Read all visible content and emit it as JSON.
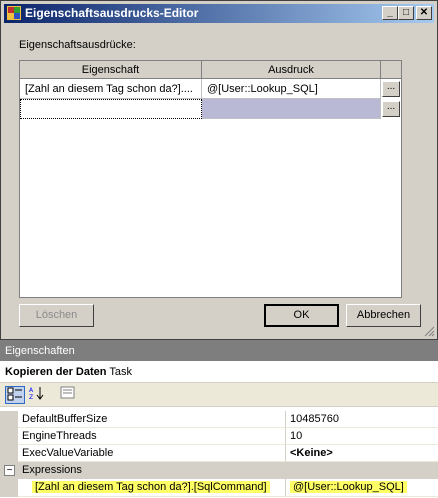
{
  "window": {
    "title": "Eigenschaftsausdrucks-Editor",
    "minimize": "_",
    "maximize": "□",
    "close": "✕"
  },
  "dialog": {
    "grid_label": "Eigenschaftsausdrücke:",
    "grid": {
      "headers": [
        "Eigenschaft",
        "Ausdruck"
      ],
      "rows": [
        {
          "property": "[Zahl an diesem Tag schon da?]....",
          "expression": "@[User::Lookup_SQL]"
        },
        {
          "property": "",
          "expression": ""
        }
      ],
      "ellipsis": "..."
    },
    "buttons": {
      "delete": "Löschen",
      "ok": "OK",
      "cancel": "Abbrechen"
    }
  },
  "properties": {
    "panel_title": "Eigenschaften",
    "object_name": "Kopieren der Daten",
    "object_type": "Task",
    "rows": [
      {
        "name": "DefaultBufferSize",
        "value": "10485760"
      },
      {
        "name": "EngineThreads",
        "value": "10"
      },
      {
        "name": "ExecValueVariable",
        "value": "<Keine>"
      }
    ],
    "category": {
      "name": "Expressions",
      "expander": "−"
    },
    "expression_row": {
      "name": "[Zahl an diesem Tag schon da?].[SqlCommand]",
      "value": "@[User::Lookup_SQL]"
    }
  },
  "colors": {
    "title_start": "#0a246a",
    "title_end": "#a6caf0",
    "selected_row": "#b9b9d5",
    "highlight": "#ffff66"
  }
}
